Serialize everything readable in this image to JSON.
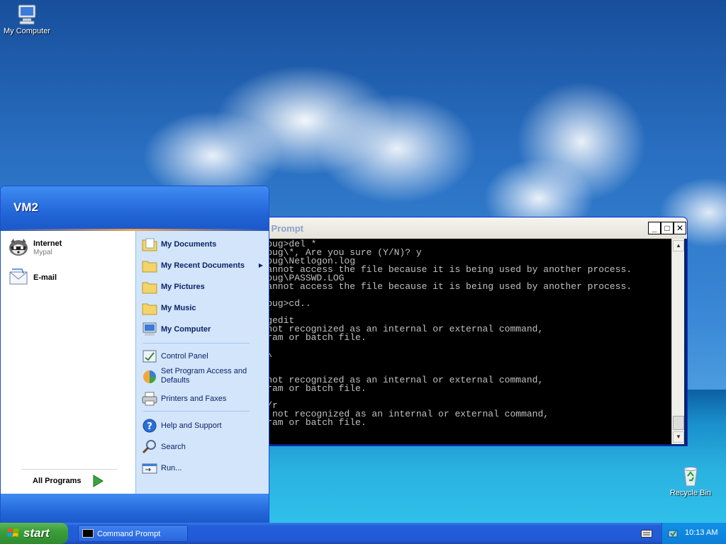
{
  "desktop": {
    "icons": [
      {
        "label": "My Computer"
      },
      {
        "label": "Recycle Bin"
      }
    ]
  },
  "cmd_window": {
    "title": "nd Prompt",
    "lines": [
      "S\\Debug>del *",
      "S\\Debug\\*, Are you sure (Y/N)? y",
      "S\\Debug\\Netlogon.log",
      "ss cannot access the file because it is being used by another process.",
      "S\\Debug\\PASSWD.LOG",
      "ss cannot access the file because it is being used by another process.",
      "",
      "S\\Debug>cd..",
      "",
      "S>regedit",
      " is not recognized as an internal or external command,",
      "program or batch file.",
      "",
      "S>cd\\",
      "",
      "it",
      " is not recognized as an internal or external command,",
      "program or batch file.",
      "",
      "own /r",
      "' is not recognized as an internal or external command,",
      "program or batch file."
    ],
    "buttons": {
      "minimize": "_",
      "maximize": "□",
      "close": "✕"
    }
  },
  "start_menu": {
    "user": "VM2",
    "pinned": [
      {
        "title": "Internet",
        "subtitle": "Mypal"
      },
      {
        "title": "E-mail",
        "subtitle": ""
      }
    ],
    "all_programs": "All Programs",
    "right": [
      {
        "label": "My Documents"
      },
      {
        "label": "My Recent Documents",
        "submenu": "▶"
      },
      {
        "label": "My Pictures"
      },
      {
        "label": "My Music"
      },
      {
        "label": "My Computer"
      },
      {
        "label": "Control Panel"
      },
      {
        "label": "Set Program Access and",
        "label2": "Defaults"
      },
      {
        "label": "Printers and Faxes"
      },
      {
        "label": "Help and Support"
      },
      {
        "label": "Search"
      },
      {
        "label": "Run..."
      }
    ]
  },
  "taskbar": {
    "start_label": "start",
    "task_item": "Command Prompt",
    "clock": "10:13 AM"
  }
}
